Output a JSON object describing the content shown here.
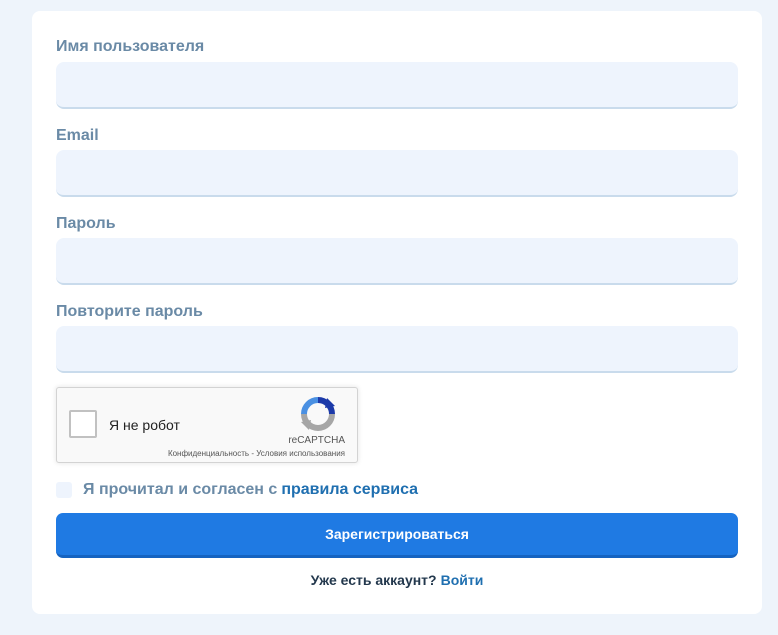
{
  "form": {
    "username": {
      "label": "Имя пользователя",
      "value": "",
      "placeholder": ""
    },
    "email": {
      "label": "Email",
      "value": "",
      "placeholder": ""
    },
    "password": {
      "label": "Пароль",
      "value": "",
      "placeholder": ""
    },
    "password_repeat": {
      "label": "Повторите пароль",
      "value": "",
      "placeholder": ""
    }
  },
  "recaptcha": {
    "label": "Я не робот",
    "brand": "reCAPTCHA",
    "privacy": "Конфиденциальность",
    "separator": " - ",
    "terms": "Условия использования",
    "checked": false
  },
  "agreement": {
    "text": "Я прочитал и согласен с",
    "link_label": "правила сервиса",
    "checked": false
  },
  "submit": {
    "label": "Зарегистрироваться"
  },
  "login": {
    "question": "Уже есть аккаунт?",
    "link_label": "Войти"
  },
  "colors": {
    "background": "#eef4fb",
    "card": "#ffffff",
    "label": "#6a8aa6",
    "input_bg": "#eef4fd",
    "primary": "#1f7ae3",
    "link": "#1f6fb0"
  },
  "icons": {
    "recaptcha_logo": "recaptcha-logo-icon"
  }
}
